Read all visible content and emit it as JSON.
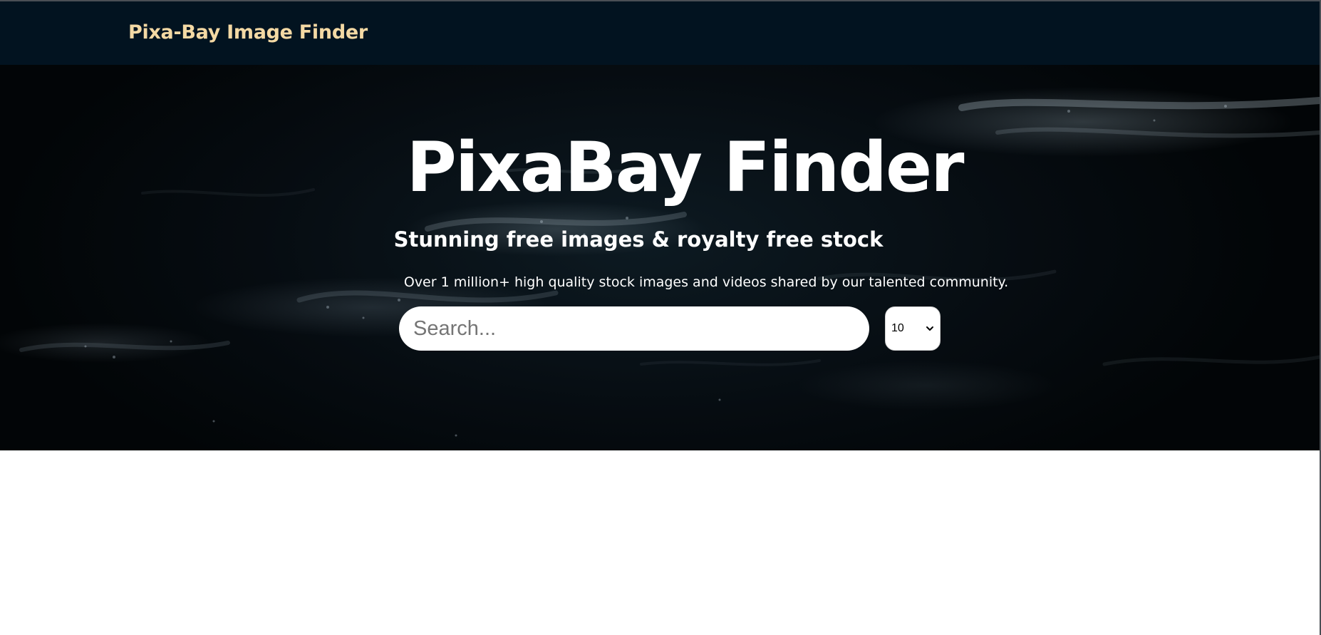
{
  "navbar": {
    "brand": "Pixa-Bay Image Finder"
  },
  "hero": {
    "title": "PixaBay Finder",
    "subtitle": "Stunning free images & royalty free stock",
    "description": "Over 1 million+ high quality stock images and videos shared by our talented community."
  },
  "search": {
    "value": "",
    "placeholder": "Search..."
  },
  "per_page": {
    "selected": "10",
    "icon": "chevron-down-icon"
  },
  "colors": {
    "navbar_bg": "#021320",
    "brand_text": "#f4d9a4",
    "hero_text": "#ffffff",
    "page_bg": "#ffffff"
  }
}
